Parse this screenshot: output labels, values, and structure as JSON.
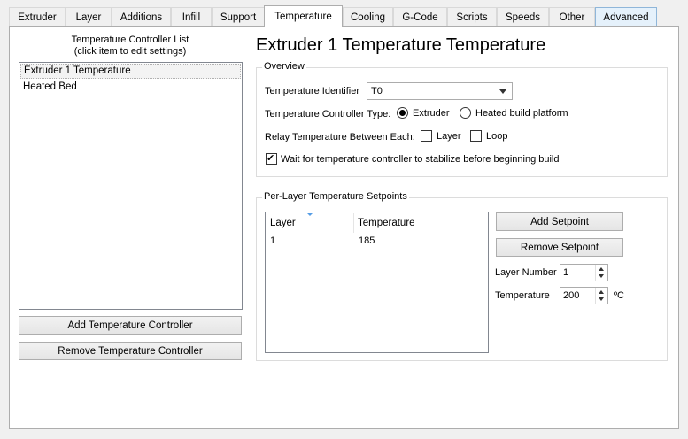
{
  "tabs": [
    {
      "label": "Extruder"
    },
    {
      "label": "Layer"
    },
    {
      "label": "Additions"
    },
    {
      "label": "Infill"
    },
    {
      "label": "Support"
    },
    {
      "label": "Temperature"
    },
    {
      "label": "Cooling"
    },
    {
      "label": "G-Code"
    },
    {
      "label": "Scripts"
    },
    {
      "label": "Speeds"
    },
    {
      "label": "Other"
    },
    {
      "label": "Advanced"
    }
  ],
  "left": {
    "list_title_line1": "Temperature Controller List",
    "list_title_line2": "(click item to edit settings)",
    "items": [
      {
        "label": "Extruder 1 Temperature",
        "selected": true
      },
      {
        "label": "Heated Bed",
        "selected": false
      }
    ],
    "add_button": "Add Temperature Controller",
    "remove_button": "Remove Temperature Controller"
  },
  "main": {
    "title": "Extruder 1 Temperature Temperature",
    "overview": {
      "group_title": "Overview",
      "identifier_label": "Temperature Identifier",
      "identifier_value": "T0",
      "type_label": "Temperature Controller Type:",
      "type_options": [
        {
          "label": "Extruder",
          "checked": true
        },
        {
          "label": "Heated build platform",
          "checked": false
        }
      ],
      "relay_label": "Relay Temperature Between Each:",
      "relay_options": [
        {
          "label": "Layer",
          "checked": false
        },
        {
          "label": "Loop",
          "checked": false
        }
      ],
      "wait_label": "Wait for temperature controller to stabilize before beginning build",
      "wait_checked": true
    },
    "setpoints": {
      "group_title": "Per-Layer Temperature Setpoints",
      "columns": [
        "Layer",
        "Temperature"
      ],
      "rows": [
        {
          "layer": "1",
          "temperature": "185"
        }
      ],
      "add_button": "Add Setpoint",
      "remove_button": "Remove Setpoint",
      "layer_number_label": "Layer Number",
      "layer_number_value": "1",
      "temperature_label": "Temperature",
      "temperature_value": "200",
      "temperature_unit": "ºC"
    }
  }
}
